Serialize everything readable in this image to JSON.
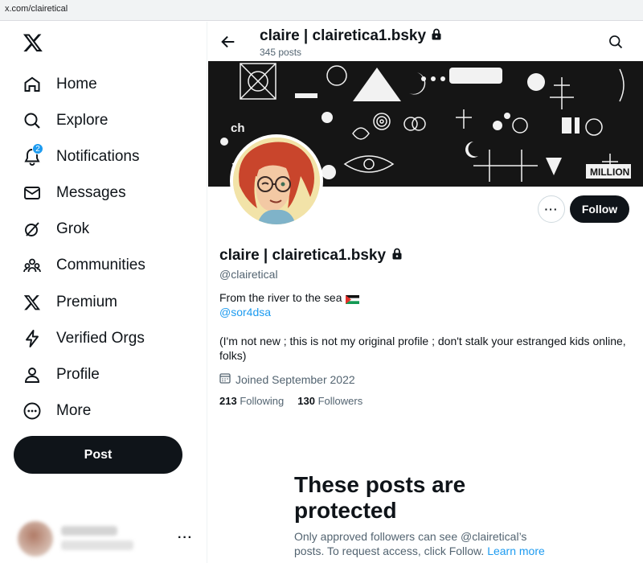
{
  "browser": {
    "url": "x.com/clairetical"
  },
  "sidebar": {
    "logo_icon": "x-logo-icon",
    "nav": [
      {
        "label": "Home",
        "icon": "home-icon"
      },
      {
        "label": "Explore",
        "icon": "search-icon"
      },
      {
        "label": "Notifications",
        "icon": "bell-icon",
        "badge": "2"
      },
      {
        "label": "Messages",
        "icon": "envelope-icon"
      },
      {
        "label": "Grok",
        "icon": "grok-icon"
      },
      {
        "label": "Communities",
        "icon": "communities-icon"
      },
      {
        "label": "Premium",
        "icon": "x-logo-icon"
      },
      {
        "label": "Verified Orgs",
        "icon": "lightning-icon"
      },
      {
        "label": "Profile",
        "icon": "person-icon"
      },
      {
        "label": "More",
        "icon": "more-circle-icon"
      }
    ],
    "post_label": "Post",
    "account_more": "···"
  },
  "header": {
    "title": "claire | clairetica1.bsky",
    "post_count": "345 posts"
  },
  "profile": {
    "name": "claire | clairetica1.bsky",
    "handle": "@clairetical",
    "bio_line1": "From the river to the sea",
    "bio_link": "@sor4dsa",
    "bio_line2": "(I'm not new ; this is not my original profile ; don't stalk your estranged kids online, folks)",
    "joined": "Joined September 2022",
    "following_count": "213",
    "following_label": "Following",
    "followers_count": "130",
    "followers_label": "Followers",
    "more_label": "···",
    "follow_label": "Follow"
  },
  "protected": {
    "title": "These posts are protected",
    "text": "Only approved followers can see @clairetical’s posts. To request access, click Follow.",
    "link": "Learn more"
  },
  "colors": {
    "accent": "#1d9bf0",
    "text": "#0f1419",
    "muted": "#536471",
    "button_dark": "#0f1419"
  }
}
